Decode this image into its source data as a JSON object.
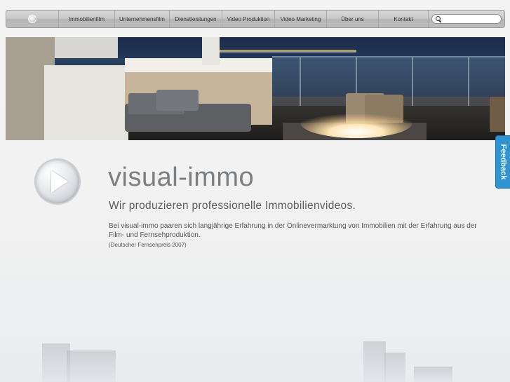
{
  "nav": {
    "items": [
      {
        "label": "Immobilienfilm"
      },
      {
        "label": "Unternehmensfilm"
      },
      {
        "label": "Dienstleistungen"
      },
      {
        "label": "Video Produktion"
      },
      {
        "label": "Video Marketing"
      },
      {
        "label": "Über uns"
      },
      {
        "label": "Kontakt"
      }
    ],
    "search": {
      "placeholder": "",
      "value": ""
    }
  },
  "hero": {
    "image": "rooftop-terrace-firepit-ocean-night"
  },
  "feedback": {
    "label": "Feedback",
    "color": "#2f93cf"
  },
  "content": {
    "brand": "visual-immo",
    "tagline": "Wir produzieren professionelle Immobilienvideos.",
    "description": "Bei visual-immo paaren sich langjährige Erfahrung in der Onlinevermarktung von Immobilien mit der Erfahrung aus der Film- und Fernsehproduktion.",
    "note": "(Deutscher Fernsehpreis 2007)"
  },
  "icons": {
    "logo": "play-disc-icon",
    "play": "play-icon",
    "search": "search-icon"
  }
}
